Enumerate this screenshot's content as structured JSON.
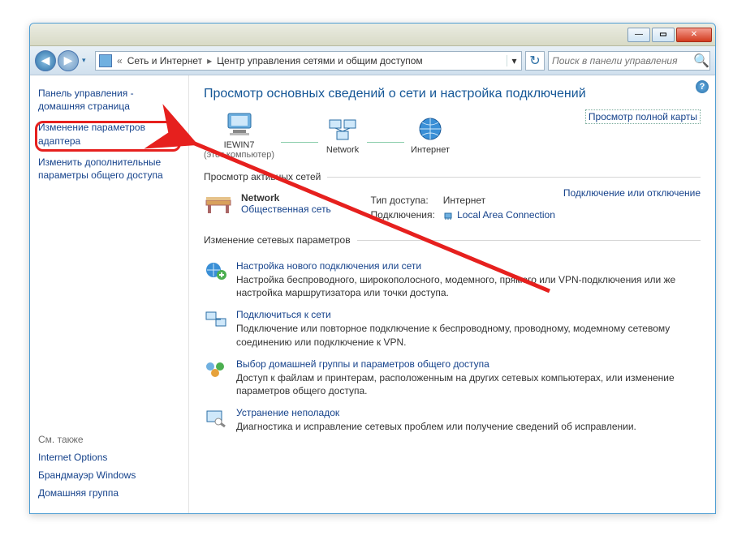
{
  "titlebar": {
    "minimize": "—",
    "maximize": "▭",
    "close": "✕"
  },
  "nav": {
    "back_glyph": "◀",
    "forward_glyph": "▶",
    "history_glyph": "▾",
    "refresh_glyph": "↻"
  },
  "address": {
    "prefix": "«",
    "seg1": "Сеть и Интернет",
    "seg2": "Центр управления сетями и общим доступом",
    "chevron": "▸",
    "drop": "▾"
  },
  "search": {
    "placeholder": "Поиск в панели управления",
    "icon": "🔍"
  },
  "help": {
    "glyph": "?"
  },
  "sidebar": {
    "cphome": "Панель управления - домашняя страница",
    "link_adapter": "Изменение параметров адаптера",
    "link_advanced": "Изменить дополнительные параметры общего доступа",
    "seealso_hdr": "См. также",
    "see1": "Internet Options",
    "see2": "Брандмауэр Windows",
    "see3": "Домашняя группа"
  },
  "main": {
    "title": "Просмотр основных сведений о сети и настройка подключений",
    "fullmap": "Просмотр полной карты",
    "map": {
      "node1": "IEWIN7",
      "node1_sub": "(этот компьютер)",
      "node2": "Network",
      "node3": "Интернет"
    },
    "active_hdr": "Просмотр активных сетей",
    "connect_toggle": "Подключение или отключение",
    "network": {
      "name": "Network",
      "type": "Общественная сеть",
      "access_lbl": "Тип доступа:",
      "access_val": "Интернет",
      "conn_lbl": "Подключения:",
      "conn_val": "Local Area Connection"
    },
    "change_hdr": "Изменение сетевых параметров",
    "tasks": [
      {
        "link": "Настройка нового подключения или сети",
        "desc": "Настройка беспроводного, широкополосного, модемного, прямого или VPN-подключения или же настройка маршрутизатора или точки доступа."
      },
      {
        "link": "Подключиться к сети",
        "desc": "Подключение или повторное подключение к беспроводному, проводному, модемному сетевому соединению или подключение к VPN."
      },
      {
        "link": "Выбор домашней группы и параметров общего доступа",
        "desc": "Доступ к файлам и принтерам, расположенным на других сетевых компьютерах, или изменение параметров общего доступа."
      },
      {
        "link": "Устранение неполадок",
        "desc": "Диагностика и исправление сетевых проблем или получение сведений об исправлении."
      }
    ]
  }
}
